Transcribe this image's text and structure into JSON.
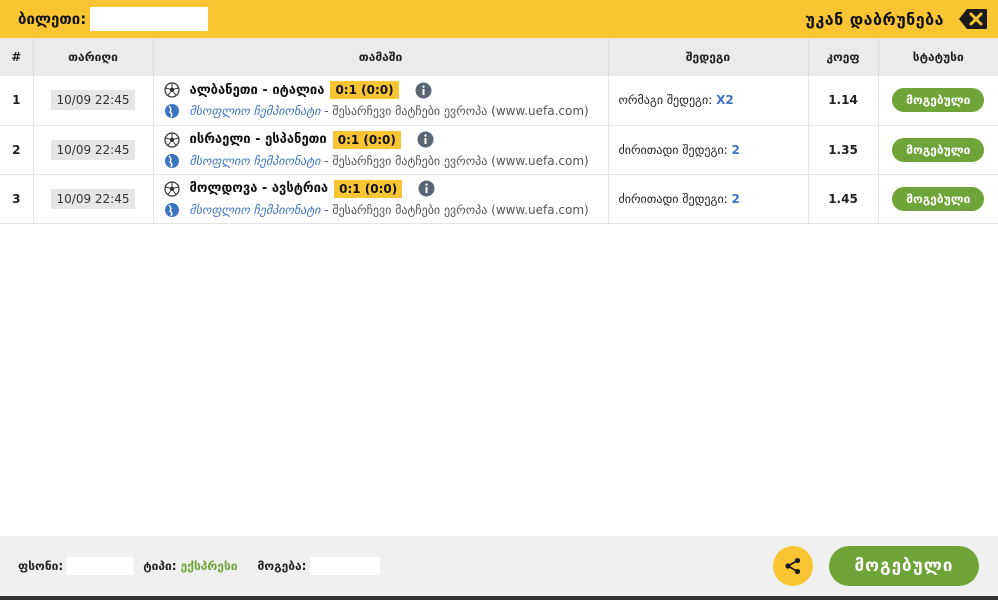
{
  "header": {
    "ticket_label": "ბილეთი:",
    "back_label": "უკან დაბრუნება"
  },
  "table": {
    "columns": [
      "#",
      "თარიღი",
      "თამაში",
      "შედეგი",
      "კოეფ",
      "სტატუსი"
    ],
    "rows": [
      {
        "num": "1",
        "date": "10/09 22:45",
        "match": "ალბანეთი - იტალია",
        "score": "0:1 (0:0)",
        "league_champ": "მსოფლიო ჩემპიონატი",
        "league_rest": " - შესარჩევი მატჩები ევროპა (www.uefa.com)",
        "bet_label": "ორმაგი შედეგი: ",
        "bet_value": "X2",
        "odd": "1.14",
        "status": "მოგებული"
      },
      {
        "num": "2",
        "date": "10/09 22:45",
        "match": "ისრაელი - ესპანეთი",
        "score": "0:1 (0:0)",
        "league_champ": "მსოფლიო ჩემპიონატი",
        "league_rest": " - შესარჩევი მატჩები ევროპა (www.uefa.com)",
        "bet_label": "ძირითადი შედეგი: ",
        "bet_value": "2",
        "odd": "1.35",
        "status": "მოგებული"
      },
      {
        "num": "3",
        "date": "10/09 22:45",
        "match": "მოლდოვა - ავსტრია",
        "score": "0:1 (0:0)",
        "league_champ": "მსოფლიო ჩემპიონატი",
        "league_rest": " - შესარჩევი მატჩები ევროპა (www.uefa.com)",
        "bet_label": "ძირითადი შედეგი: ",
        "bet_value": "2",
        "odd": "1.45",
        "status": "მოგებული"
      }
    ]
  },
  "footer": {
    "stake_label": "ფსონი:",
    "type_label": "ტიპი:",
    "type_value": "ექსპრესი",
    "win_label": "მოგება:",
    "result_button": "მოგებული"
  },
  "icons": {
    "back": "backspace-close-icon",
    "ball": "soccer-ball-icon",
    "info": "info-icon",
    "globe": "globe-icon",
    "share": "share-icon"
  },
  "colors": {
    "accent_yellow": "#f9c532",
    "win_green": "#6fa538",
    "league_blue": "#3d74c2"
  }
}
